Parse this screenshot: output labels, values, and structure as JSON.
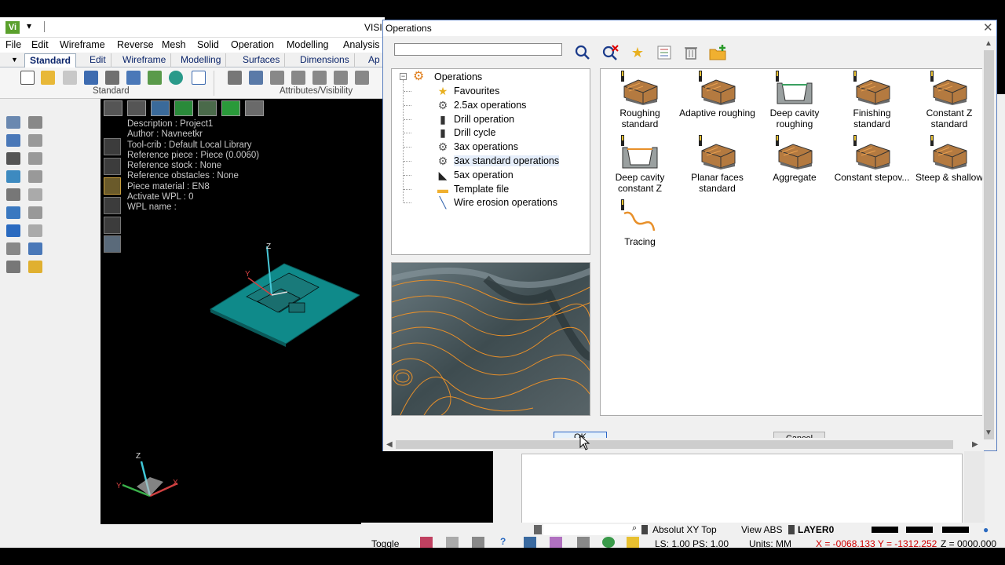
{
  "app": {
    "title": "VISI",
    "logo": "Vi",
    "quick_access": "▾",
    "menu": [
      "File",
      "Edit",
      "Wireframe",
      "Reverse",
      "Mesh",
      "Solid",
      "Operation",
      "Modelling",
      "Analysis"
    ],
    "tabs": [
      "Standard",
      "Edit",
      "Wireframe",
      "Modelling",
      "Surfaces",
      "Dimensions",
      "Ap"
    ],
    "active_tab": "Standard",
    "ribbon_groups": [
      "Standard",
      "Attributes/Visibility"
    ]
  },
  "viewport": {
    "info_lines": [
      "Description : Project1",
      "Author : Navneetkr",
      "Tool-crib : Default Local Library",
      "Reference piece : Piece (0.0060)",
      "Reference stock : None",
      "Reference obstacles : None",
      "Piece material : EN8",
      "Activate WPL : 0",
      "WPL name :"
    ],
    "axes": {
      "z": "Z",
      "y": "Y",
      "x": "X"
    }
  },
  "dialog": {
    "title": "Operations",
    "close": "✕",
    "search_value": "",
    "tools": [
      "search-icon",
      "clear-filter-icon",
      "favourite-star-icon",
      "list-filter-icon",
      "delete-icon",
      "add-folder-icon"
    ],
    "tree": {
      "root": "Operations",
      "expander": "−",
      "items": [
        {
          "label": "Favourites",
          "icon": "star-icon",
          "glyph": "★"
        },
        {
          "label": "2.5ax operations",
          "icon": "gear-icon",
          "glyph": "⚙"
        },
        {
          "label": "Drill operation",
          "icon": "drill-icon",
          "glyph": "▮"
        },
        {
          "label": "Drill cycle",
          "icon": "drill-cycle-icon",
          "glyph": "▮"
        },
        {
          "label": "3ax operations",
          "icon": "gear-icon",
          "glyph": "⚙"
        },
        {
          "label": "3ax standard operations",
          "icon": "gear-icon",
          "glyph": "⚙"
        },
        {
          "label": "5ax operation",
          "icon": "five-axis-icon",
          "glyph": "◣"
        },
        {
          "label": "Template file",
          "icon": "folder-icon",
          "glyph": "▬"
        },
        {
          "label": "Wire erosion operations",
          "icon": "wire-icon",
          "glyph": "╲"
        }
      ],
      "selected_index": 5
    },
    "operations": [
      {
        "label": "Roughing standard"
      },
      {
        "label": "Adaptive roughing"
      },
      {
        "label": "Deep cavity roughing"
      },
      {
        "label": "Finishing standard"
      },
      {
        "label": "Constant Z standard"
      },
      {
        "label": "Deep cavity constant Z"
      },
      {
        "label": "Planar faces standard"
      },
      {
        "label": "Aggregate"
      },
      {
        "label": "Constant stepov..."
      },
      {
        "label": "Steep & shallow"
      },
      {
        "label": "Tracing"
      }
    ],
    "ok_label": "OK",
    "cancel_label": "Cancel"
  },
  "statusbar": {
    "toggle": "Toggle",
    "view_mode": "Absolut XY Top",
    "view_abs": "View ABS",
    "layer": "LAYER0",
    "ls_ps": "LS: 1.00 PS: 1.00",
    "units": "Units: MM",
    "coords": "X = -0068.133 Y = -1312.252",
    "z_coord": "Z = 0000.000"
  },
  "colors": {
    "accent_blue": "#0a246a",
    "model_teal": "#0f8a8a",
    "toolpath_orange": "#e8902a",
    "coord_red": "#d00000"
  }
}
